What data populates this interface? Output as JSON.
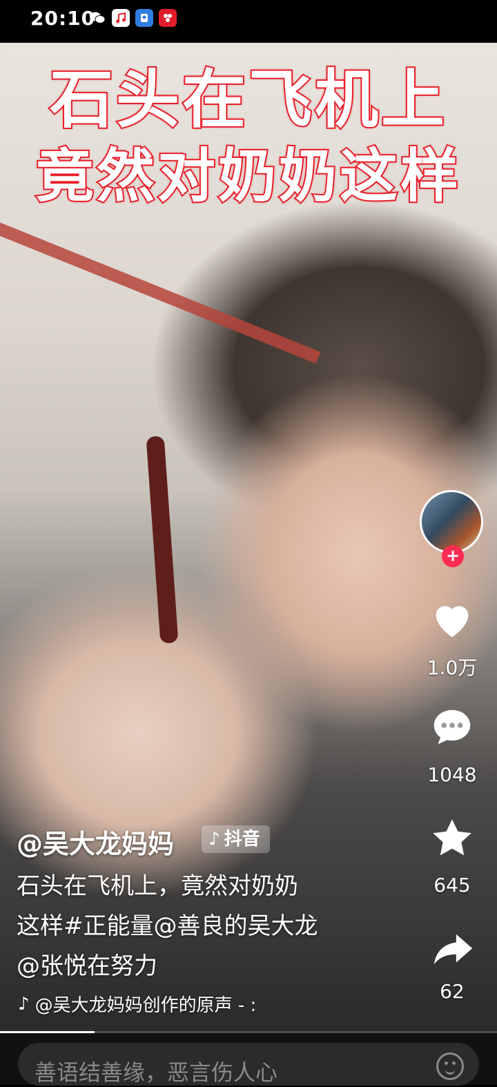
{
  "status_bar": {
    "time": "20:10",
    "icons": [
      "wechat-icon",
      "music-app-icon",
      "blue-app-icon",
      "red-app-icon"
    ]
  },
  "video": {
    "headline_line1": "石头在飞机上",
    "headline_line2": "竟然对奶奶这样"
  },
  "actions": {
    "like_count": "1.0万",
    "comment_count": "1048",
    "favorite_count": "645",
    "share_count": "62"
  },
  "post": {
    "author": "@吴大龙妈妈",
    "platform_badge": "抖音",
    "caption_line1": "石头在飞机上，竟然对奶奶",
    "caption_line2": "这样#正能量@善良的吴大龙",
    "caption_line3": "@张悦在努力",
    "music": "@吴大龙妈妈创作的原声 - :"
  },
  "progress": {
    "fraction": 0.19
  },
  "comment_bar": {
    "placeholder": "善语结善缘，恶言伤人心"
  },
  "colors": {
    "accent": "#fe2c55",
    "headline_stroke": "#e8202c"
  }
}
